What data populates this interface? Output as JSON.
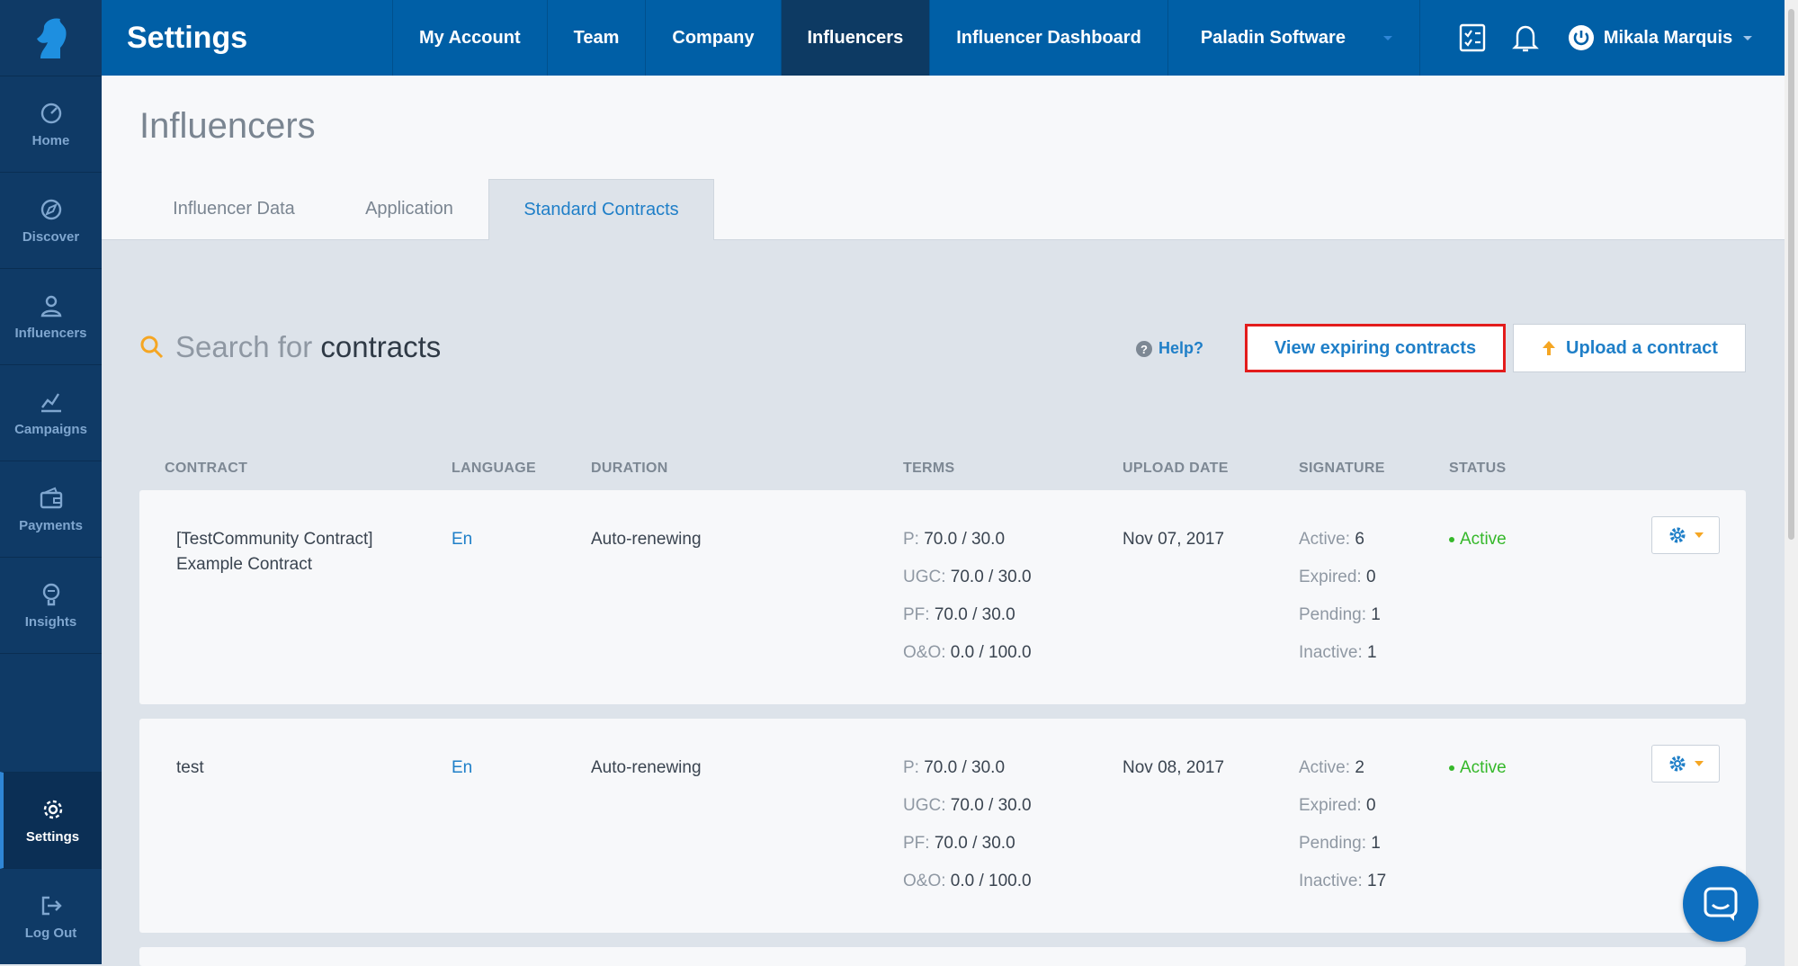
{
  "app": {
    "title": "Settings",
    "company": "Paladin Software",
    "user": "Mikala Marquis"
  },
  "sidebar": {
    "items": [
      {
        "label": "Home",
        "icon": "gauge-icon"
      },
      {
        "label": "Discover",
        "icon": "compass-icon"
      },
      {
        "label": "Influencers",
        "icon": "person-icon"
      },
      {
        "label": "Campaigns",
        "icon": "chart-icon"
      },
      {
        "label": "Payments",
        "icon": "wallet-icon"
      },
      {
        "label": "Insights",
        "icon": "lightbulb-icon"
      }
    ],
    "settings": "Settings",
    "logout": "Log Out"
  },
  "nav": {
    "items": [
      "My Account",
      "Team",
      "Company",
      "Influencers",
      "Influencer Dashboard"
    ],
    "active": "Influencers"
  },
  "page": {
    "title": "Influencers",
    "tabs": [
      "Influencer Data",
      "Application",
      "Standard Contracts"
    ],
    "active_tab": "Standard Contracts"
  },
  "search": {
    "prefix": "Search for",
    "term": "contracts"
  },
  "actions": {
    "help": "Help?",
    "view_expiring": "View expiring contracts",
    "upload": "Upload a contract"
  },
  "table": {
    "columns": [
      "CONTRACT",
      "LANGUAGE",
      "DURATION",
      "TERMS",
      "UPLOAD DATE",
      "SIGNATURE",
      "STATUS"
    ],
    "rows": [
      {
        "name_line1": "[TestCommunity Contract]",
        "name_line2": "Example Contract",
        "language": "En",
        "duration": "Auto-renewing",
        "terms": [
          {
            "label": "P:",
            "value": "70.0 / 30.0"
          },
          {
            "label": "UGC:",
            "value": "70.0 / 30.0"
          },
          {
            "label": "PF:",
            "value": "70.0 / 30.0"
          },
          {
            "label": "O&O:",
            "value": "0.0 / 100.0"
          }
        ],
        "upload_date": "Nov 07, 2017",
        "signature": [
          {
            "label": "Active:",
            "value": "6"
          },
          {
            "label": "Expired:",
            "value": "0"
          },
          {
            "label": "Pending:",
            "value": "1"
          },
          {
            "label": "Inactive:",
            "value": "1"
          }
        ],
        "status": "Active"
      },
      {
        "name_line1": "test",
        "name_line2": "",
        "language": "En",
        "duration": "Auto-renewing",
        "terms": [
          {
            "label": "P:",
            "value": "70.0 / 30.0"
          },
          {
            "label": "UGC:",
            "value": "70.0 / 30.0"
          },
          {
            "label": "PF:",
            "value": "70.0 / 30.0"
          },
          {
            "label": "O&O:",
            "value": "0.0 / 100.0"
          }
        ],
        "upload_date": "Nov 08, 2017",
        "signature": [
          {
            "label": "Active:",
            "value": "2"
          },
          {
            "label": "Expired:",
            "value": "0"
          },
          {
            "label": "Pending:",
            "value": "1"
          },
          {
            "label": "Inactive:",
            "value": "17"
          }
        ],
        "status": "Active"
      }
    ]
  },
  "colors": {
    "sidebar": "#0f3a66",
    "topbar": "#005fa6",
    "accent": "#1f7fc8",
    "active_status": "#35b82a",
    "highlight": "#e31c1c",
    "star": "#f5a623"
  }
}
